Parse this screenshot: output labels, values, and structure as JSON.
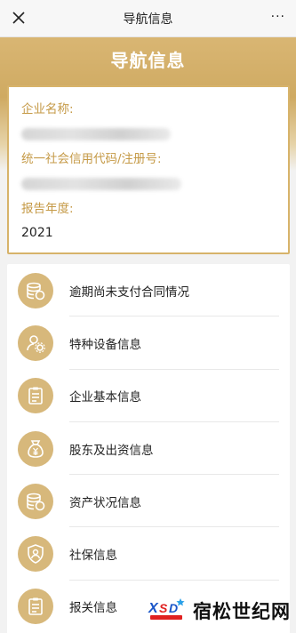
{
  "topbar": {
    "title": "导航信息",
    "close_icon": "close-icon",
    "more_label": "···"
  },
  "hero": {
    "title": "导航信息"
  },
  "info": {
    "company_label": "企业名称:",
    "credit_code_label": "统一社会信用代码/注册号:",
    "year_label": "报告年度:",
    "year_value": "2021"
  },
  "menu": {
    "items": [
      {
        "label": "逾期尚未支付合同情况",
        "icon": "coins-stack-icon"
      },
      {
        "label": "特种设备信息",
        "icon": "user-gear-icon"
      },
      {
        "label": "企业基本信息",
        "icon": "clipboard-icon"
      },
      {
        "label": "股东及出资信息",
        "icon": "money-bag-icon"
      },
      {
        "label": "资产状况信息",
        "icon": "coins-stack-icon"
      },
      {
        "label": "社保信息",
        "icon": "shield-user-icon"
      },
      {
        "label": "报关信息",
        "icon": "clipboard-icon"
      }
    ]
  },
  "watermark": {
    "logo_text": "XSD",
    "logo_subtext": "宿松世纪网",
    "text": "宿松世纪网"
  },
  "colors": {
    "accent_gold": "#d7b36a",
    "label_gold": "#c59a47",
    "icon_bg": "#d7b87b"
  }
}
